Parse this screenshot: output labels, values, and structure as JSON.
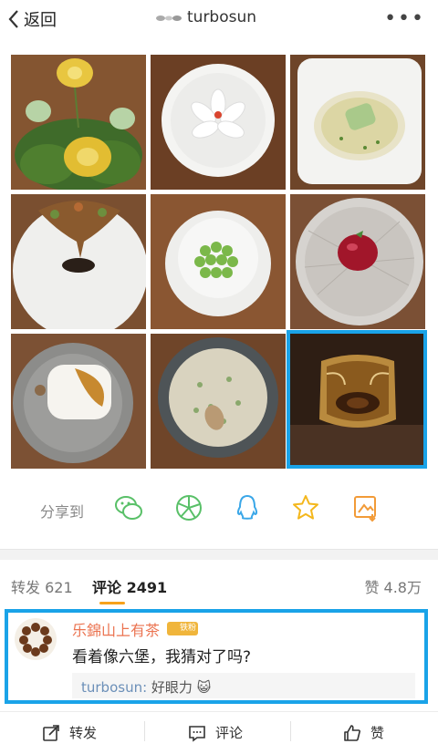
{
  "header": {
    "back_label": "返回",
    "title": "turbosun",
    "more_label": "•••"
  },
  "photos": [
    {
      "name": "dish-flowers-moss"
    },
    {
      "name": "dish-white-lotus"
    },
    {
      "name": "dish-broth-bowl"
    },
    {
      "name": "dish-tree-plate"
    },
    {
      "name": "dish-green-peas"
    },
    {
      "name": "dish-red-dessert"
    },
    {
      "name": "dish-tofu-plate"
    },
    {
      "name": "dish-risotto"
    },
    {
      "name": "dish-amber-tea"
    }
  ],
  "share": {
    "label": "分享到",
    "icons": [
      "wechat-icon",
      "moments-icon",
      "qq-icon",
      "favorite-star-icon",
      "save-image-icon"
    ]
  },
  "tabs": {
    "repost": "转发 621",
    "comments": "评论 2491",
    "likes": "赞 4.8万"
  },
  "comment": {
    "user": "乐錦山上有茶",
    "badge": "铁粉",
    "text": "看着像六堡，我猜对了吗?",
    "reply_user": "turbosun:",
    "reply_text": " 好眼力 😺"
  },
  "bottom": {
    "repost": "转发",
    "comment": "评论",
    "like": "赞"
  },
  "colors": {
    "highlight": "#1aa3e8",
    "username": "#eb7350",
    "tab_underline": "#f7a21b"
  }
}
